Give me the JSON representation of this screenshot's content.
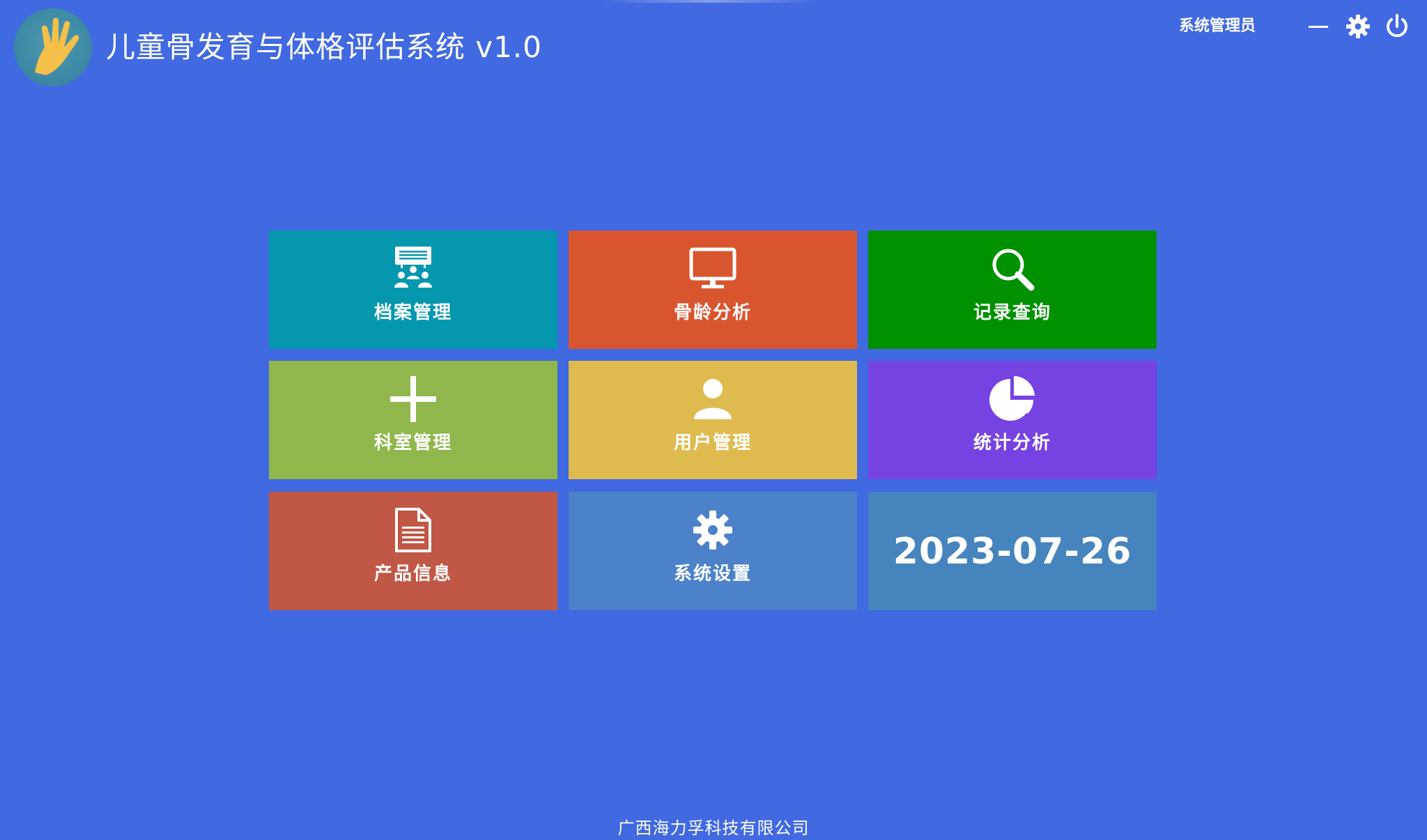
{
  "window": {
    "title": "儿童骨发育与体格评估系统 v1.0",
    "current_user": "系统管理员",
    "logo_icon": "hand-logo-icon",
    "controls": {
      "minimize_icon": "minimize-icon",
      "settings_icon": "gear-icon",
      "power_icon": "power-icon"
    }
  },
  "tiles": [
    {
      "key": "archive",
      "label": "档案管理",
      "icon": "group-presentation-icon",
      "color": "#0497ae"
    },
    {
      "key": "bone_age",
      "label": "骨龄分析",
      "icon": "monitor-icon",
      "color": "#d9552e"
    },
    {
      "key": "record_query",
      "label": "记录查询",
      "icon": "search-icon",
      "color": "#009100"
    },
    {
      "key": "department",
      "label": "科室管理",
      "icon": "plus-icon",
      "color": "#8fb74c"
    },
    {
      "key": "user",
      "label": "用户管理",
      "icon": "user-icon",
      "color": "#dfbb4f"
    },
    {
      "key": "statistics",
      "label": "统计分析",
      "icon": "pie-chart-icon",
      "color": "#7642e2"
    },
    {
      "key": "product",
      "label": "产品信息",
      "icon": "document-icon",
      "color": "#c15745"
    },
    {
      "key": "system_settings",
      "label": "系统设置",
      "icon": "gear-icon",
      "color": "#4b82c9"
    }
  ],
  "date_tile": {
    "date": "2023-07-26",
    "color": "#4584bd"
  },
  "footer": {
    "company": "广西海力孚科技有限公司"
  },
  "colors": {
    "background": "#4169e1",
    "text": "#ffffff"
  }
}
